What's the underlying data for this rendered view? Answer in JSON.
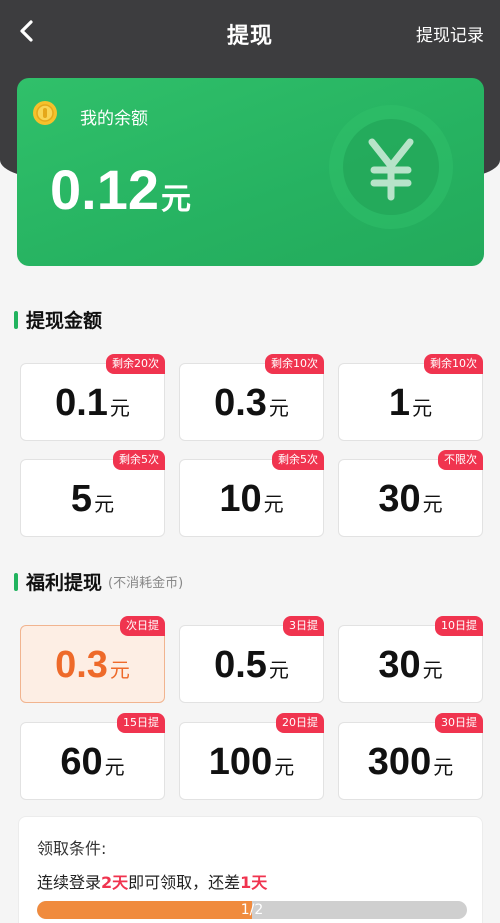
{
  "header": {
    "title": "提现",
    "record_link": "提现记录"
  },
  "balance": {
    "label": "我的余额",
    "amount": "0.12",
    "unit": "元"
  },
  "withdraw_section": {
    "title": "提现金额",
    "options": [
      {
        "value": "0.1",
        "unit": "元",
        "badge": "剩余20次"
      },
      {
        "value": "0.3",
        "unit": "元",
        "badge": "剩余10次"
      },
      {
        "value": "1",
        "unit": "元",
        "badge": "剩余10次"
      },
      {
        "value": "5",
        "unit": "元",
        "badge": "剩余5次"
      },
      {
        "value": "10",
        "unit": "元",
        "badge": "剩余5次"
      },
      {
        "value": "30",
        "unit": "元",
        "badge": "不限次"
      }
    ]
  },
  "welfare_section": {
    "title": "福利提现",
    "subtitle": "(不消耗金币)",
    "options": [
      {
        "value": "0.3",
        "unit": "元",
        "badge": "次日提",
        "selected": true
      },
      {
        "value": "0.5",
        "unit": "元",
        "badge": "3日提"
      },
      {
        "value": "30",
        "unit": "元",
        "badge": "10日提"
      },
      {
        "value": "60",
        "unit": "元",
        "badge": "15日提"
      },
      {
        "value": "100",
        "unit": "元",
        "badge": "20日提"
      },
      {
        "value": "300",
        "unit": "元",
        "badge": "30日提"
      }
    ]
  },
  "condition": {
    "title": "领取条件:",
    "text_part1": "连续登录",
    "days_required": "2天",
    "text_part2": "即可领取，还差",
    "days_left": "1天",
    "progress_text": "1/2",
    "progress_fraction": 0.5
  },
  "colors": {
    "accent_green": "#26b261",
    "badge_red": "#f0344f",
    "selected_orange": "#ee6a2a",
    "progress_orange": "#f08b3e"
  }
}
